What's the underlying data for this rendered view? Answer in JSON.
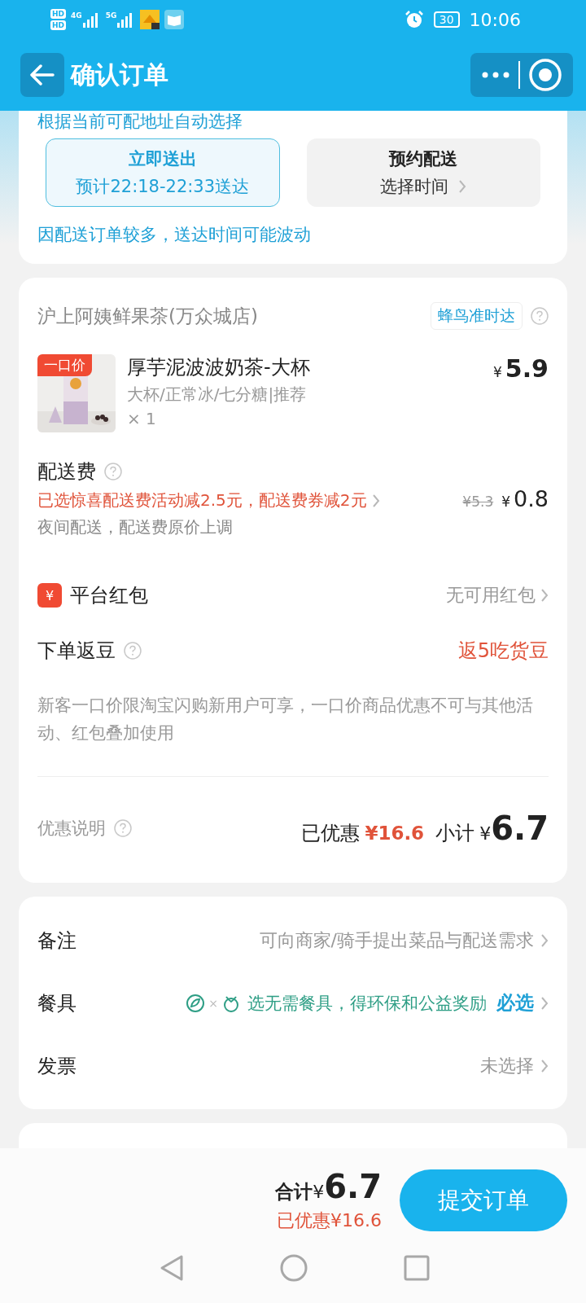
{
  "status_bar": {
    "indicators": [
      "HD",
      "HD",
      "4G",
      "5G"
    ],
    "battery": "30",
    "time": "10:06"
  },
  "header": {
    "title": "确认订单"
  },
  "delivery_card": {
    "note_top": "根据当前可配地址自动选择",
    "options": [
      {
        "title": "立即送出",
        "subtitle": "预计22:18-22:33送达",
        "selected": true,
        "chevron": false
      },
      {
        "title": "预约配送",
        "subtitle": "选择时间",
        "selected": false,
        "chevron": true
      }
    ],
    "note": "因配送订单较多，送达时间可能波动"
  },
  "shop_card": {
    "shop_name": "沪上阿姨鲜果茶(万众城店)",
    "tag": "蜂鸟准时达",
    "item": {
      "badge": "一口价",
      "name": "厚芋泥波波奶茶-大杯",
      "specs": "大杯/正常冰/七分糖|推荐",
      "quantity": "× 1",
      "currency": "¥",
      "price": "5.9"
    },
    "delivery_fee": {
      "label": "配送费",
      "promo": "已选惊喜配送费活动减2.5元，配送费券减2元",
      "note": "夜间配送，配送费原价上调",
      "original_price": "¥5.3",
      "currency": "¥",
      "price": "0.8"
    },
    "rows": [
      {
        "kind": "redpacket",
        "icon": "¥",
        "label": "平台红包",
        "value": "无可用红包"
      },
      {
        "kind": "beans",
        "label": "下单返豆",
        "value": "返5吃货豆"
      }
    ],
    "disclaimer": "新客一口价限淘宝闪购新用户可享，一口价商品优惠不可与其他活动、红包叠加使用",
    "summary": {
      "label": "优惠说明",
      "saved_label": "已优惠",
      "saved": "¥16.6",
      "subtotal_label": "小计",
      "currency": "¥",
      "subtotal": "6.7"
    }
  },
  "options_card": {
    "rows": [
      {
        "kind": "plain",
        "label": "备注",
        "value": "可向商家/骑手提出菜品与配送需求"
      },
      {
        "kind": "eco",
        "label": "餐具",
        "times": "×",
        "value": "选无需餐具，得环保和公益奖励",
        "action": "必选"
      },
      {
        "kind": "plain",
        "label": "发票",
        "value": "未选择"
      }
    ]
  },
  "footer": {
    "total_label": "合计",
    "currency": "¥",
    "total": "6.7",
    "saved": "已优惠¥16.6",
    "submit": "提交订单"
  }
}
